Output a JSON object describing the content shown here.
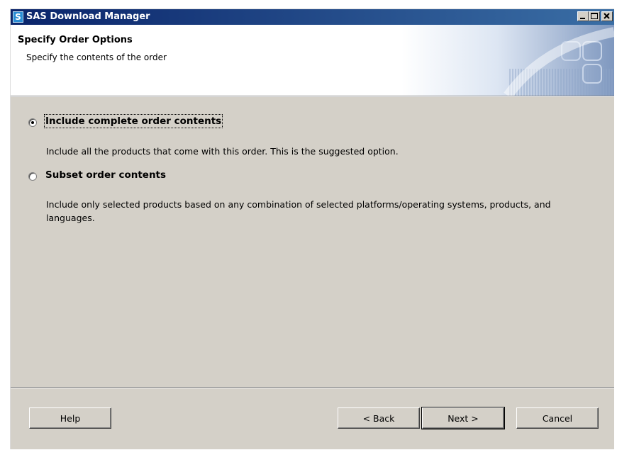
{
  "window": {
    "title": "SAS Download Manager",
    "app_icon_glyph": "S",
    "controls": [
      "minimize-icon",
      "maximize-icon",
      "close-icon"
    ]
  },
  "header": {
    "title": "Specify Order Options",
    "subtitle": "Specify the contents of the order"
  },
  "options": [
    {
      "label": "Include complete order contents",
      "description": "Include all the products that come with this order. This is the suggested option.",
      "selected": true
    },
    {
      "label": "Subset order contents",
      "description": "Include only selected products based on any combination of selected platforms/operating systems, products, and languages.",
      "selected": false
    }
  ],
  "buttons": {
    "help": "Help",
    "back": "< Back",
    "next": "Next >",
    "cancel": "Cancel"
  },
  "colors": {
    "titlebar_start": "#0a246a",
    "titlebar_end": "#3a6ea5",
    "dialog_face": "#d4d0c8"
  }
}
